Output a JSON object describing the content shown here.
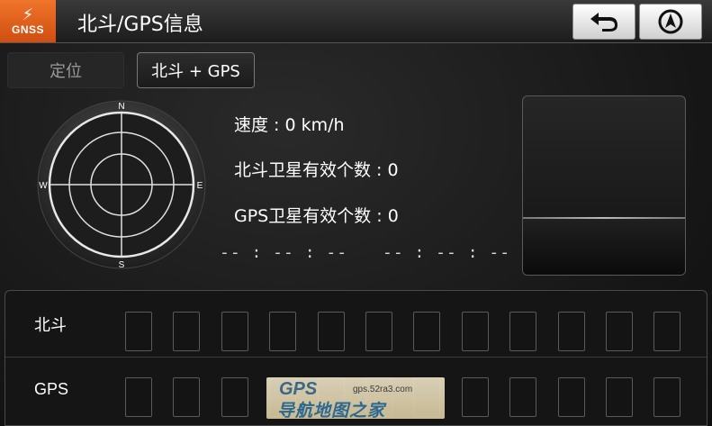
{
  "header": {
    "logo_glyph": "⚡",
    "logo_text": "GNSS",
    "title": "北斗/GPS信息",
    "back_button_icon": "back-arrow-icon",
    "nav_button_icon": "navigation-arrow-icon"
  },
  "tabs": [
    {
      "label": "定位",
      "active": false
    },
    {
      "label": "北斗 + GPS",
      "active": true
    }
  ],
  "compass": {
    "north": "N",
    "south": "S",
    "east": "E",
    "west": "W"
  },
  "info": {
    "speed": "速度 : 0 km/h",
    "beidou_count": "北斗卫星有效个数 : 0",
    "gps_count": "GPS卫星有效个数 : 0"
  },
  "times": {
    "time_1": "-- : -- : --",
    "time_2": "-- : -- : --"
  },
  "satellites": {
    "beidou_label": "北斗",
    "gps_label": "GPS",
    "beidou_slot_count": 12,
    "gps_slot_count": 12
  },
  "watermark": {
    "logo": "GPS",
    "url": "gps.52ra3.com",
    "text": "导航地图之家"
  },
  "colors": {
    "logo_bg": "#e55f1c",
    "background": "#1a1a1a",
    "text": "#ffffff",
    "inactive_tab_text": "#9a9a9a"
  }
}
